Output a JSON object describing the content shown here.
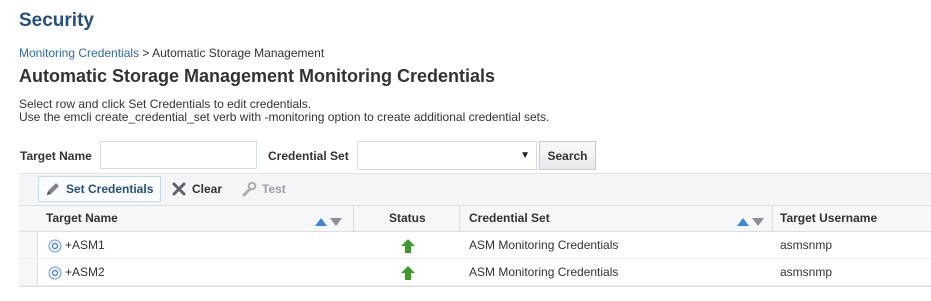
{
  "app_title": "Security",
  "breadcrumb": {
    "link": "Monitoring Credentials",
    "separator": ">",
    "current": "Automatic Storage Management"
  },
  "page_title": "Automatic Storage Management Monitoring Credentials",
  "instructions": {
    "line1": "Select row and click Set Credentials to edit credentials.",
    "line2": "Use the emcli create_credential_set verb with -monitoring option to create additional credential sets."
  },
  "search": {
    "target_name_label": "Target Name",
    "target_name_value": "",
    "credential_set_label": "Credential Set",
    "credential_set_value": "",
    "search_label": "Search"
  },
  "toolbar": {
    "set_credentials": "Set Credentials",
    "clear": "Clear",
    "test": "Test"
  },
  "table": {
    "columns": [
      "Target Name",
      "Status",
      "Credential Set",
      "Target Username"
    ],
    "rows": [
      {
        "target_name": "+ASM1",
        "status": "up",
        "credential_set": "ASM Monitoring Credentials",
        "target_username": "asmsnmp"
      },
      {
        "target_name": "+ASM2",
        "status": "up",
        "credential_set": "ASM Monitoring Credentials",
        "target_username": "asmsnmp"
      }
    ]
  },
  "colors": {
    "title": "#245079",
    "link": "#2a6ba4",
    "sort_active": "#3b87d6",
    "status_up": "#3a9a2a"
  }
}
